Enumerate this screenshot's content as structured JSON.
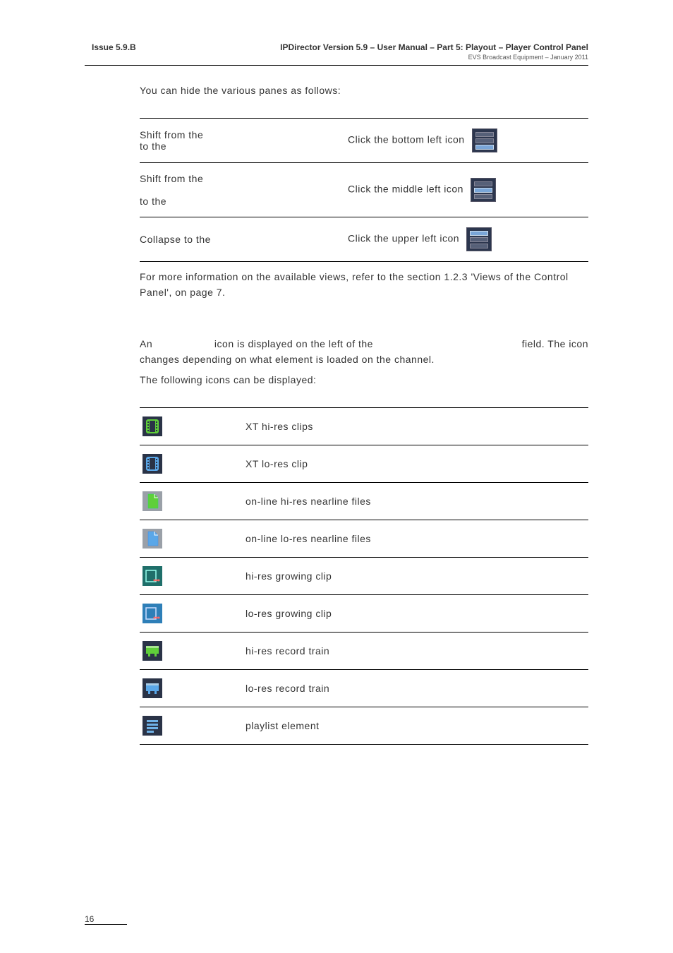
{
  "header": {
    "issue": "Issue 5.9.B",
    "title": "IPDirector Version 5.9 – User Manual – Part 5: Playout – Player Control Panel",
    "subtitle": "EVS Broadcast Equipment – January 2011"
  },
  "intro_text": "You can hide the various panes as follows:",
  "views_table": [
    {
      "left1": "Shift from the",
      "left2": "to the",
      "action_text": "Click the bottom left icon",
      "highlight": "bottom"
    },
    {
      "left1": "Shift  from  the",
      "left2": "to  the",
      "action_text": "Click the middle left icon",
      "highlight": "middle"
    },
    {
      "left1": "Collapse to the",
      "left2": "",
      "action_text": "Click the upper left icon",
      "highlight": "top"
    }
  ],
  "views_note": "For more information on the available views, refer to the section 1.2.3 'Views of the Control Panel', on page 7.",
  "element_icon_para": {
    "left": "An",
    "mid": "icon is displayed on the left of the",
    "right": "field. The icon",
    "line2": "changes depending on what element is loaded on the channel.",
    "line3": "The following icons can be displayed:"
  },
  "icons_table": [
    {
      "name": "xt-hi-res-clips-icon",
      "label": "XT hi-res clips",
      "svg_key": "clip_green"
    },
    {
      "name": "xt-lo-res-clip-icon",
      "label": "XT lo-res clip",
      "svg_key": "clip_blue"
    },
    {
      "name": "online-hi-res-nearline-icon",
      "label": "on-line hi-res nearline files",
      "svg_key": "file_green"
    },
    {
      "name": "online-lo-res-nearline-icon",
      "label": "on-line lo-res nearline files",
      "svg_key": "file_blue"
    },
    {
      "name": "hi-res-growing-clip-icon",
      "label": "hi-res growing clip",
      "svg_key": "grow_green"
    },
    {
      "name": "lo-res-growing-clip-icon",
      "label": "lo-res growing clip",
      "svg_key": "grow_blue"
    },
    {
      "name": "hi-res-record-train-icon",
      "label": "hi-res record train",
      "svg_key": "train_green"
    },
    {
      "name": "lo-res-record-train-icon",
      "label": "lo-res record train",
      "svg_key": "train_blue"
    },
    {
      "name": "playlist-element-icon",
      "label": "playlist element",
      "svg_key": "playlist"
    }
  ],
  "page_number": "16"
}
